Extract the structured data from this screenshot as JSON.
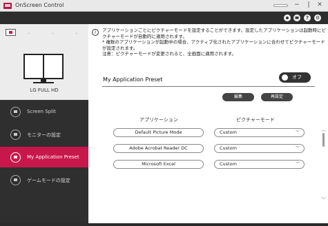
{
  "window": {
    "title": "OnScreen Control",
    "minimize": "−",
    "maximize": "|",
    "close": "✕"
  },
  "topbar": {
    "icons": [
      "settings-icon",
      "display-icon",
      "help-icon",
      "gear-icon"
    ],
    "help_glyph": "?",
    "gear_glyph": "⚙"
  },
  "sidebar": {
    "monitor_name": "LG FULL HD",
    "items": [
      {
        "label": "Screen Split",
        "icon": "screen-split-icon"
      },
      {
        "label": "モニターの設定",
        "icon": "monitor-settings-icon"
      },
      {
        "label": "My Application Preset",
        "icon": "app-preset-icon",
        "active": true
      },
      {
        "label": "ゲームモードの設定",
        "icon": "game-mode-icon"
      }
    ],
    "accent": "#c8174a"
  },
  "main": {
    "info": "アプリケーションごとにピクチャーモードを設定することができます。設定したアプリケーションは起動時にピクチャーモードが自動的に適用されます。\n* 複数のアプリケーションが起動中の場合、アクティブ化されたアプリケーションに合わせてピクチャーモードが設定されます。\n注意：ピクチャーモードが変更されると、全画面に適用されます。",
    "preset_title": "My Application Preset",
    "toggle_label": "オフ",
    "edit_button": "編集",
    "reset_button": "再設定",
    "col_app": "アプリケーション",
    "col_mode": "ピクチャーモード",
    "rows": [
      {
        "app": "Default Picture Mode",
        "mode": "Custom"
      },
      {
        "app": "Adobe Acrobat Reader DC",
        "mode": "Custom"
      },
      {
        "app": "Microsoft Excel",
        "mode": "Custom"
      }
    ]
  }
}
